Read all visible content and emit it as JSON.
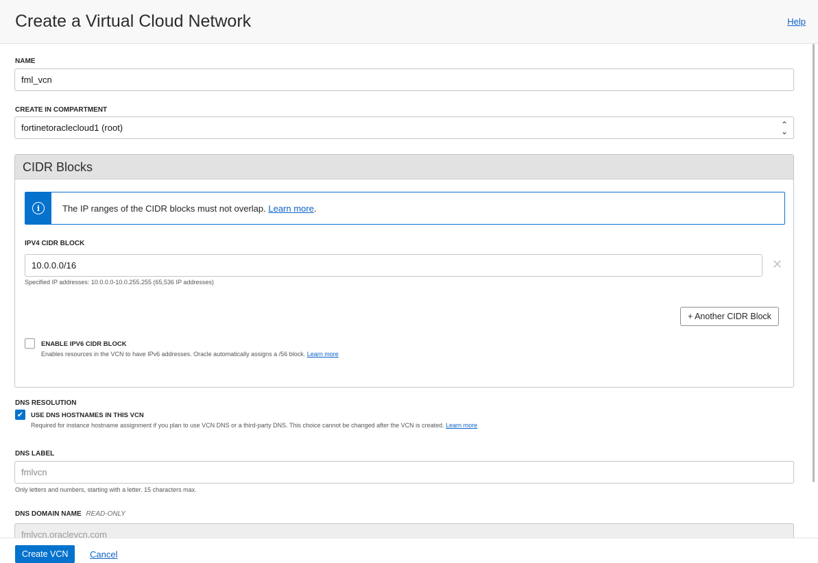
{
  "header": {
    "title": "Create a Virtual Cloud Network",
    "help_label": "Help"
  },
  "name_field": {
    "label": "NAME",
    "value": "fml_vcn"
  },
  "compartment_field": {
    "label": "CREATE IN COMPARTMENT",
    "value": "fortinetoraclecloud1 (root)"
  },
  "cidr_section": {
    "title": "CIDR Blocks",
    "info_text": "The IP ranges of the CIDR blocks must not overlap.",
    "info_link": "Learn more",
    "info_period": ".",
    "ipv4_label": "IPV4 CIDR BLOCK",
    "ipv4_value": "10.0.0.0/16",
    "ipv4_hint": "Specified IP addresses: 10.0.0.0-10.0.255.255 (65,536 IP addresses)",
    "another_button": "+ Another CIDR Block",
    "ipv6_label": "ENABLE IPV6 CIDR BLOCK",
    "ipv6_help": "Enables resources in the VCN to have IPv6 addresses. Oracle automatically assigns a /56 block.",
    "ipv6_link": "Learn more",
    "ipv6_checked": false
  },
  "dns": {
    "section_label": "DNS RESOLUTION",
    "checkbox_label": "USE DNS HOSTNAMES IN THIS VCN",
    "checkbox_checked": true,
    "checkbox_help": "Required for instance hostname assignment if you plan to use VCN DNS or a third-party DNS. This choice cannot be changed after the VCN is created.",
    "checkbox_link": "Learn more",
    "label_field_label": "DNS LABEL",
    "label_placeholder": "fmlvcn",
    "label_hint": "Only letters and numbers, starting with a letter. 15 characters max.",
    "domain_label": "DNS DOMAIN NAME",
    "domain_readonly_tag": "READ-ONLY",
    "domain_value": "fmlvcn.oraclevcn.com"
  },
  "footer": {
    "create_button": "Create VCN",
    "cancel_link": "Cancel"
  },
  "colors": {
    "accent": "#0572ce",
    "link": "#0b62c7",
    "header_bg": "#f8f8f8",
    "section_bg": "#e2e2e2"
  }
}
